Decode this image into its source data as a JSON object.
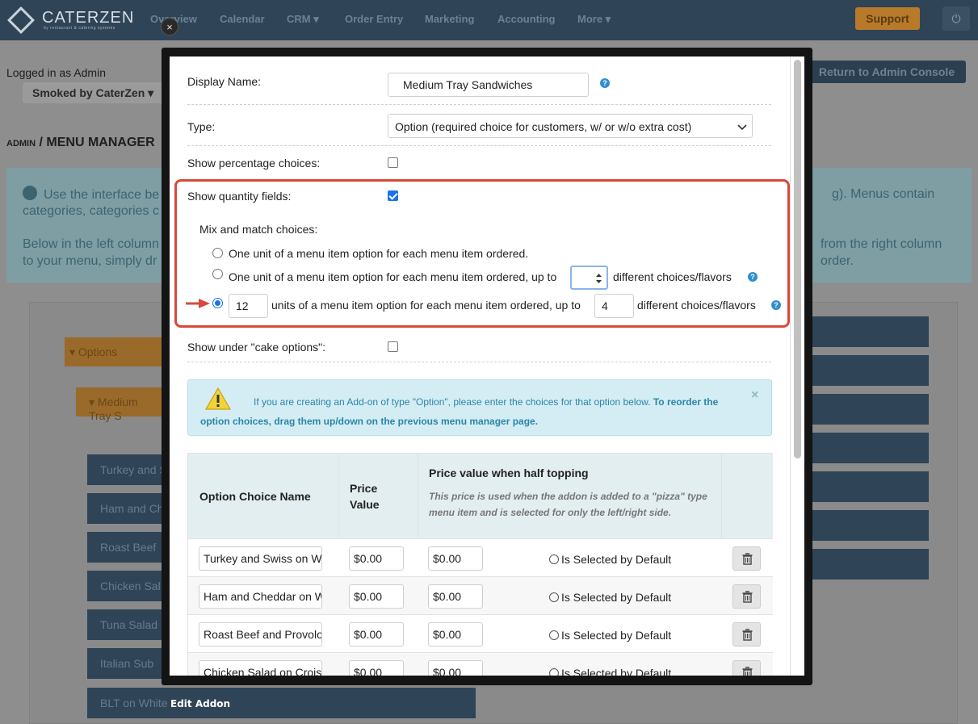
{
  "topbar": {
    "brand": "CATERZEN",
    "brand_sub": "by restaurant & catering systems",
    "nav": [
      {
        "label": "Overview"
      },
      {
        "label": "Calendar"
      },
      {
        "label": "CRM ▾"
      },
      {
        "label": "Order Entry"
      },
      {
        "label": "Marketing"
      },
      {
        "label": "Accounting"
      },
      {
        "label": "More ▾"
      }
    ],
    "support_label": "Support"
  },
  "background": {
    "logged_in": "Logged in as Admin",
    "account_name": "Smoked by CaterZen ▾",
    "return_label": "Return to Admin Console",
    "breadcrumb_admin": "ADMIN",
    "breadcrumb_sep": " / ",
    "breadcrumb_page": "MENU MANAGER",
    "info_line1_left": "Use the interface be",
    "info_line1_right": "g). Menus contain",
    "info_line2_left": "categories, categories c",
    "info_line3_left": "Below in the left column",
    "info_line3_right": "from the right column",
    "info_line4_left": "to your menu, simply dr",
    "info_line4_right": "order.",
    "options_label": "Options",
    "medium_label": "Medium Tray S",
    "items": [
      "Turkey and S",
      "Ham and Ch",
      "Roast Beef",
      "Chicken Sal",
      "Tuna Salad",
      "Italian Sub"
    ],
    "blt_label": "BLT on White"
  },
  "modal": {
    "title": "Edit Addon",
    "close_symbol": "×",
    "display_name_label": "Display Name:",
    "display_name_value": "Medium Tray Sandwiches",
    "type_label": "Type:",
    "type_value": "Option (required choice for customers, w/ or w/o extra cost)",
    "show_pct_label": "Show percentage choices:",
    "show_qty_label": "Show quantity fields:",
    "mix_label": "Mix and match choices:",
    "choice1": "One unit of a menu item option for each menu item ordered.",
    "choice2_a": "One unit of a menu item option for each menu item ordered, up to",
    "choice2_b": "different choices/flavors",
    "choice3_units": "12",
    "choice3_a": "units of a menu item option for each menu item ordered, up to",
    "choice3_max": "4",
    "choice3_b": "different choices/flavors",
    "cake_label": "Show under \"cake options\":",
    "alert_normal": "If you are creating an Add-on of type \"Option\", please enter the choices for that option below. ",
    "alert_bold": "To reorder the option choices, drag them up/down on the previous menu manager page.",
    "alert_close": "×",
    "table": {
      "col_name": "Option Choice Name",
      "col_price_1": "Price",
      "col_price_2": "Value",
      "col_half": "Price value when half topping",
      "col_half_note": "This price is used when the addon is added to a \"pizza\" type menu item and is selected for only the left/right side.",
      "default_label": "Is Selected by Default",
      "rows": [
        {
          "name": "Turkey and Swiss on W",
          "price": "$0.00",
          "half": "$0.00"
        },
        {
          "name": "Ham and Cheddar on W",
          "price": "$0.00",
          "half": "$0.00"
        },
        {
          "name": "Roast Beef and Provolo",
          "price": "$0.00",
          "half": "$0.00"
        },
        {
          "name": "Chicken Salad on Crois",
          "price": "$0.00",
          "half": "$0.00"
        }
      ]
    }
  },
  "colors": {
    "accent": "#1a73e8",
    "highlight_border": "#d64a3a",
    "alert_bg": "#d4edf4"
  }
}
